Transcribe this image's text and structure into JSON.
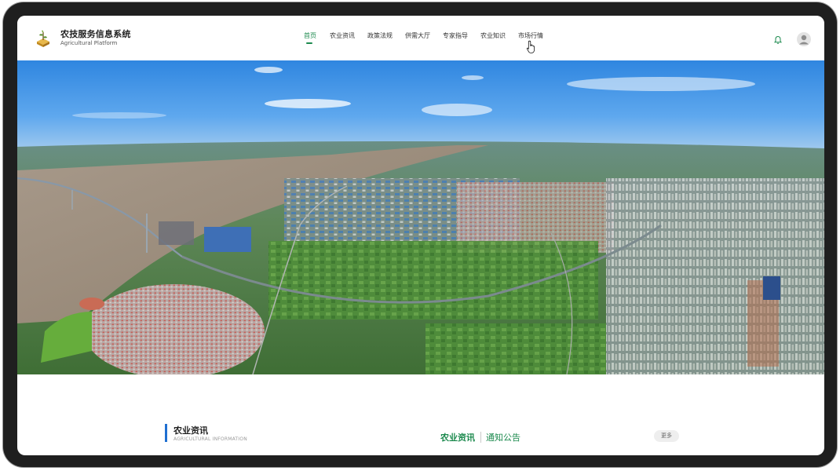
{
  "brand": {
    "title": "农技服务信息系统",
    "subtitle": "Agricultural Platform",
    "accent_color": "#1c8a4e"
  },
  "nav": {
    "items": [
      {
        "label": "首页",
        "active": true
      },
      {
        "label": "农业资讯",
        "active": false
      },
      {
        "label": "政策法规",
        "active": false
      },
      {
        "label": "供需大厅",
        "active": false
      },
      {
        "label": "专家指导",
        "active": false
      },
      {
        "label": "农业知识",
        "active": false
      },
      {
        "label": "市场行情",
        "active": false
      }
    ]
  },
  "header_icons": {
    "notification": "bell-icon",
    "user": "user-avatar-icon"
  },
  "banner": {
    "image": "aerial-cityscape-bridge-river"
  },
  "news_section": {
    "title": "农业资讯",
    "subtitle": "AGRICULTURAL INFORMATION",
    "bar_color": "#1f6fd1"
  },
  "tabs": {
    "active": "农业资讯",
    "other": "通知公告"
  },
  "more_button": {
    "label": "更多"
  }
}
